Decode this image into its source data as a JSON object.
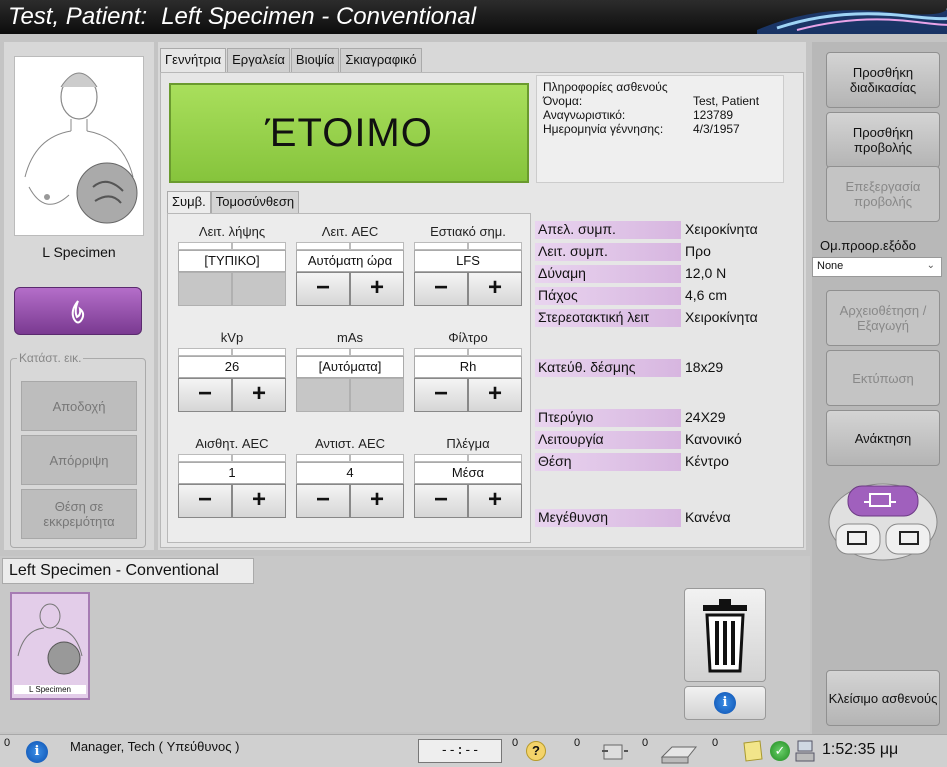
{
  "title": {
    "patient": "Test, Patient:",
    "procedure": "Left Specimen - Conventional"
  },
  "left": {
    "specimen_label": "L Specimen",
    "expose_icon": "flame-icon",
    "image_status_title": "Κατάστ. εικ.",
    "buttons": {
      "accept": "Αποδοχή",
      "reject": "Απόρριψη",
      "pending": "Θέση σε εκκρεμότητα"
    }
  },
  "tabs": [
    "Γεννήτρια",
    "Εργαλεία",
    "Βιοψία",
    "Σκιαγραφικό"
  ],
  "ready_text": "ΈΤΟΙΜΟ",
  "patient_info": {
    "title": "Πληροφορίες ασθενούς",
    "name_label": "Όνομα:",
    "name_value": "Test, Patient",
    "id_label": "Αναγνωριστικό:",
    "id_value": "123789",
    "dob_label": "Ημερομηνία γέννησης:",
    "dob_value": "4/3/1957"
  },
  "subtabs": [
    "Συμβ.",
    "Τομοσύνθεση"
  ],
  "params": {
    "mode": {
      "label": "Λειτ. λήψης",
      "value": "[ΤΥΠΙΚΟ]"
    },
    "aec_mode": {
      "label": "Λειτ. AEC",
      "value": "Αυτόματη ώρα"
    },
    "focal": {
      "label": "Εστιακό σημ.",
      "value": "LFS"
    },
    "kvp": {
      "label": "kVp",
      "value": "26"
    },
    "mas": {
      "label": "mAs",
      "value": "[Αυτόματα]"
    },
    "filter": {
      "label": "Φίλτρο",
      "value": "Rh"
    },
    "aec_sens": {
      "label": "Αισθητ. AEC",
      "value": "1"
    },
    "aec_comp": {
      "label": "Αντιστ. AEC",
      "value": "4"
    },
    "grid": {
      "label": "Πλέγμα",
      "value": "Μέσα"
    },
    "minus": "−",
    "plus": "+"
  },
  "compression": {
    "release_label": "Απελ. συμπ.",
    "release_value": "Χειροκίνητα",
    "mode_label": "Λειτ. συμπ.",
    "mode_value": "Προ",
    "force_label": "Δύναμη",
    "force_value": "12,0 N",
    "thickness_label": "Πάχος",
    "thickness_value": "4,6 cm",
    "stereo_label": "Στερεοτακτική λειτ",
    "stereo_value": "Χειροκίνητα",
    "beam_label": "Κατεύθ. δέσμης",
    "beam_value": "18x29",
    "paddle_label": "Πτερύγιο",
    "paddle_value": "24X29",
    "function_label": "Λειτουργία",
    "function_value": "Κανονικό",
    "position_label": "Θέση",
    "position_value": "Κέντρο",
    "mag_label": "Μεγέθυνση",
    "mag_value": "Κανένα"
  },
  "right": {
    "add_procedure": "Προσθήκη διαδικασίας",
    "add_view": "Προσθήκη προβολής",
    "edit_view": "Επεξεργασία προβολής",
    "output_group_label": "Ομ.προορ.εξόδο",
    "output_group_value": "None",
    "archive": "Αρχειοθέτηση / Εξαγωγή",
    "print": "Εκτύπωση",
    "retrieve": "Ανάκτηση",
    "close_patient": "Κλείσιμο ασθενούς"
  },
  "bottom": {
    "procedure_tab": "Left Specimen - Conventional",
    "thumb_label": "L Specimen"
  },
  "status": {
    "left_count": "0",
    "user": "Manager, Tech ( Υπεύθυνος )",
    "timer": "--:--",
    "c1": "0",
    "c2": "0",
    "c3": "0",
    "c4": "0",
    "clock": "1:52:35 μμ"
  },
  "colors": {
    "ready_green": "#9ad24c",
    "expose_purple": "#9a52b0",
    "param_highlight": "#dcbce5"
  }
}
